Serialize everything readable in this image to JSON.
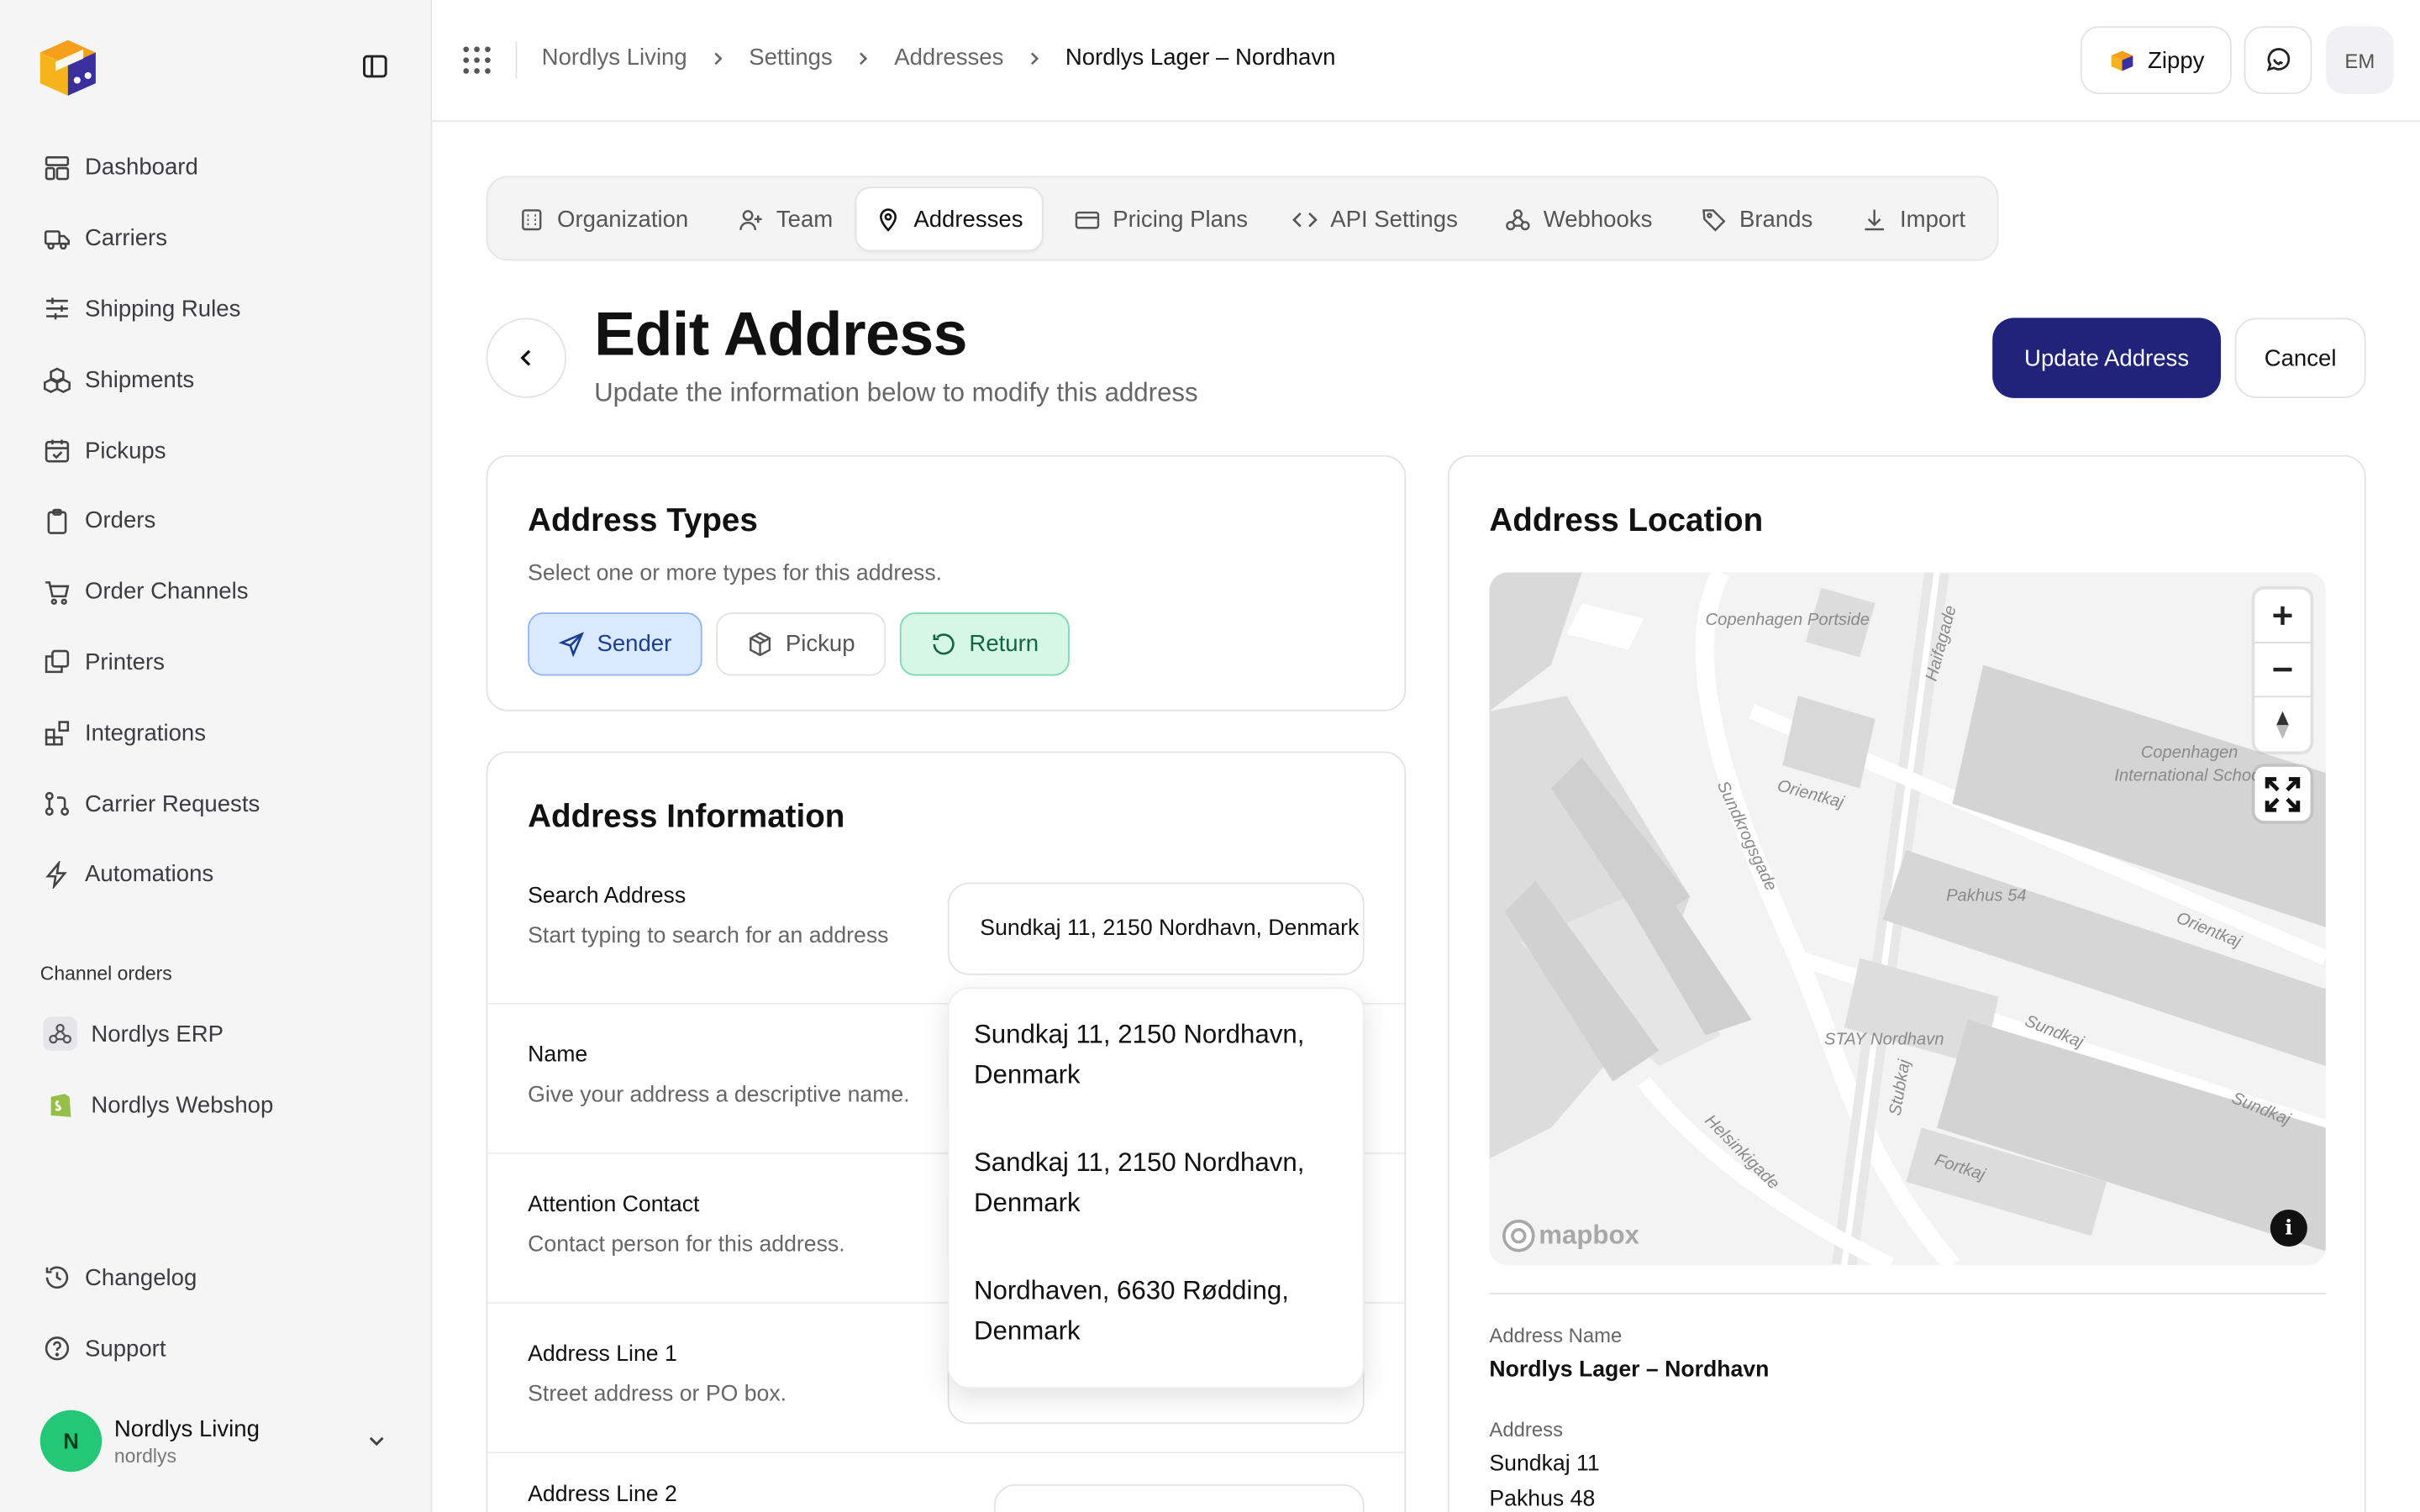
{
  "sidebar": {
    "nav": [
      {
        "label": "Dashboard",
        "icon": "dashboard-icon"
      },
      {
        "label": "Carriers",
        "icon": "truck-icon"
      },
      {
        "label": "Shipping Rules",
        "icon": "sliders-icon"
      },
      {
        "label": "Shipments",
        "icon": "boxes-icon"
      },
      {
        "label": "Pickups",
        "icon": "calendar-check-icon"
      },
      {
        "label": "Orders",
        "icon": "clipboard-icon"
      },
      {
        "label": "Order Channels",
        "icon": "cart-icon"
      },
      {
        "label": "Printers",
        "icon": "copy-icon"
      },
      {
        "label": "Integrations",
        "icon": "blocks-icon"
      },
      {
        "label": "Carrier Requests",
        "icon": "git-pull-icon"
      },
      {
        "label": "Automations",
        "icon": "bolt-icon"
      }
    ],
    "channels_label": "Channel orders",
    "channels": [
      {
        "label": "Nordlys ERP",
        "icon": "webhook-icon"
      },
      {
        "label": "Nordlys Webshop",
        "icon": "shopify-icon"
      }
    ],
    "bottom": [
      {
        "label": "Changelog",
        "icon": "history-icon"
      },
      {
        "label": "Support",
        "icon": "help-circle-icon"
      }
    ],
    "account": {
      "initial": "N",
      "name": "Nordlys Living",
      "slug": "nordlys"
    }
  },
  "header": {
    "breadcrumb": [
      "Nordlys Living",
      "Settings",
      "Addresses",
      "Nordlys Lager – Nordhavn"
    ],
    "zippy_label": "Zippy",
    "user_initials": "EM"
  },
  "tabs": [
    {
      "label": "Organization",
      "icon": "building-icon"
    },
    {
      "label": "Team",
      "icon": "user-plus-icon"
    },
    {
      "label": "Addresses",
      "icon": "map-pin-icon",
      "active": true
    },
    {
      "label": "Pricing Plans",
      "icon": "credit-card-icon"
    },
    {
      "label": "API Settings",
      "icon": "code-icon"
    },
    {
      "label": "Webhooks",
      "icon": "webhook-icon"
    },
    {
      "label": "Brands",
      "icon": "tag-icon"
    },
    {
      "label": "Import",
      "icon": "download-icon"
    }
  ],
  "page": {
    "title": "Edit Address",
    "subtitle": "Update the information below to modify this address",
    "update_label": "Update Address",
    "cancel_label": "Cancel"
  },
  "address_types": {
    "title": "Address Types",
    "description": "Select one or more types for this address.",
    "sender": "Sender",
    "pickup": "Pickup",
    "return": "Return"
  },
  "address_info": {
    "title": "Address Information",
    "search_label": "Search Address",
    "search_desc": "Start typing to search for an address",
    "search_value": "Sundkaj 11, 2150 Nordhavn, Denmark",
    "name_label": "Name",
    "name_desc": "Give your address a descriptive name.",
    "attention_label": "Attention Contact",
    "attention_desc": "Contact person for this address.",
    "line1_label": "Address Line 1",
    "line1_desc": "Street address or PO box.",
    "line2_label": "Address Line 2",
    "suggestions": [
      "Sundkaj 11, 2150 Nordhavn, Denmark",
      "Sandkaj 11, 2150 Nordhavn, Denmark",
      "Nordhaven, 6630 Rødding, Denmark"
    ]
  },
  "location": {
    "title": "Address Location",
    "map_labels": {
      "portside": "Copenhagen Portside",
      "haifagade": "Haifagade",
      "school": "Copenhagen International School",
      "orientkaj_1": "Orientkaj",
      "orientkaj_2": "Orientkaj",
      "sundkrogsgade": "Sundkrogsgade",
      "pakhus": "Pakhus 54",
      "sundkaj_1": "Sundkaj",
      "sundkaj_2": "Sundkaj",
      "stay": "STAY Nordhavn",
      "stubkaj": "Stubkaj",
      "helsinkigade": "Helsinkigade",
      "fortkaj": "Fortkaj"
    },
    "map_brand": "mapbox",
    "name_label": "Address Name",
    "name_value": "Nordlys Lager – Nordhavn",
    "address_label": "Address",
    "address_line1": "Sundkaj 11",
    "address_line2": "Pakhus 48"
  },
  "colors": {
    "primary": "#21227a",
    "sender_bg": "#dbe9ff",
    "return_bg": "#d6f6e6",
    "avatar": "#23c775"
  }
}
